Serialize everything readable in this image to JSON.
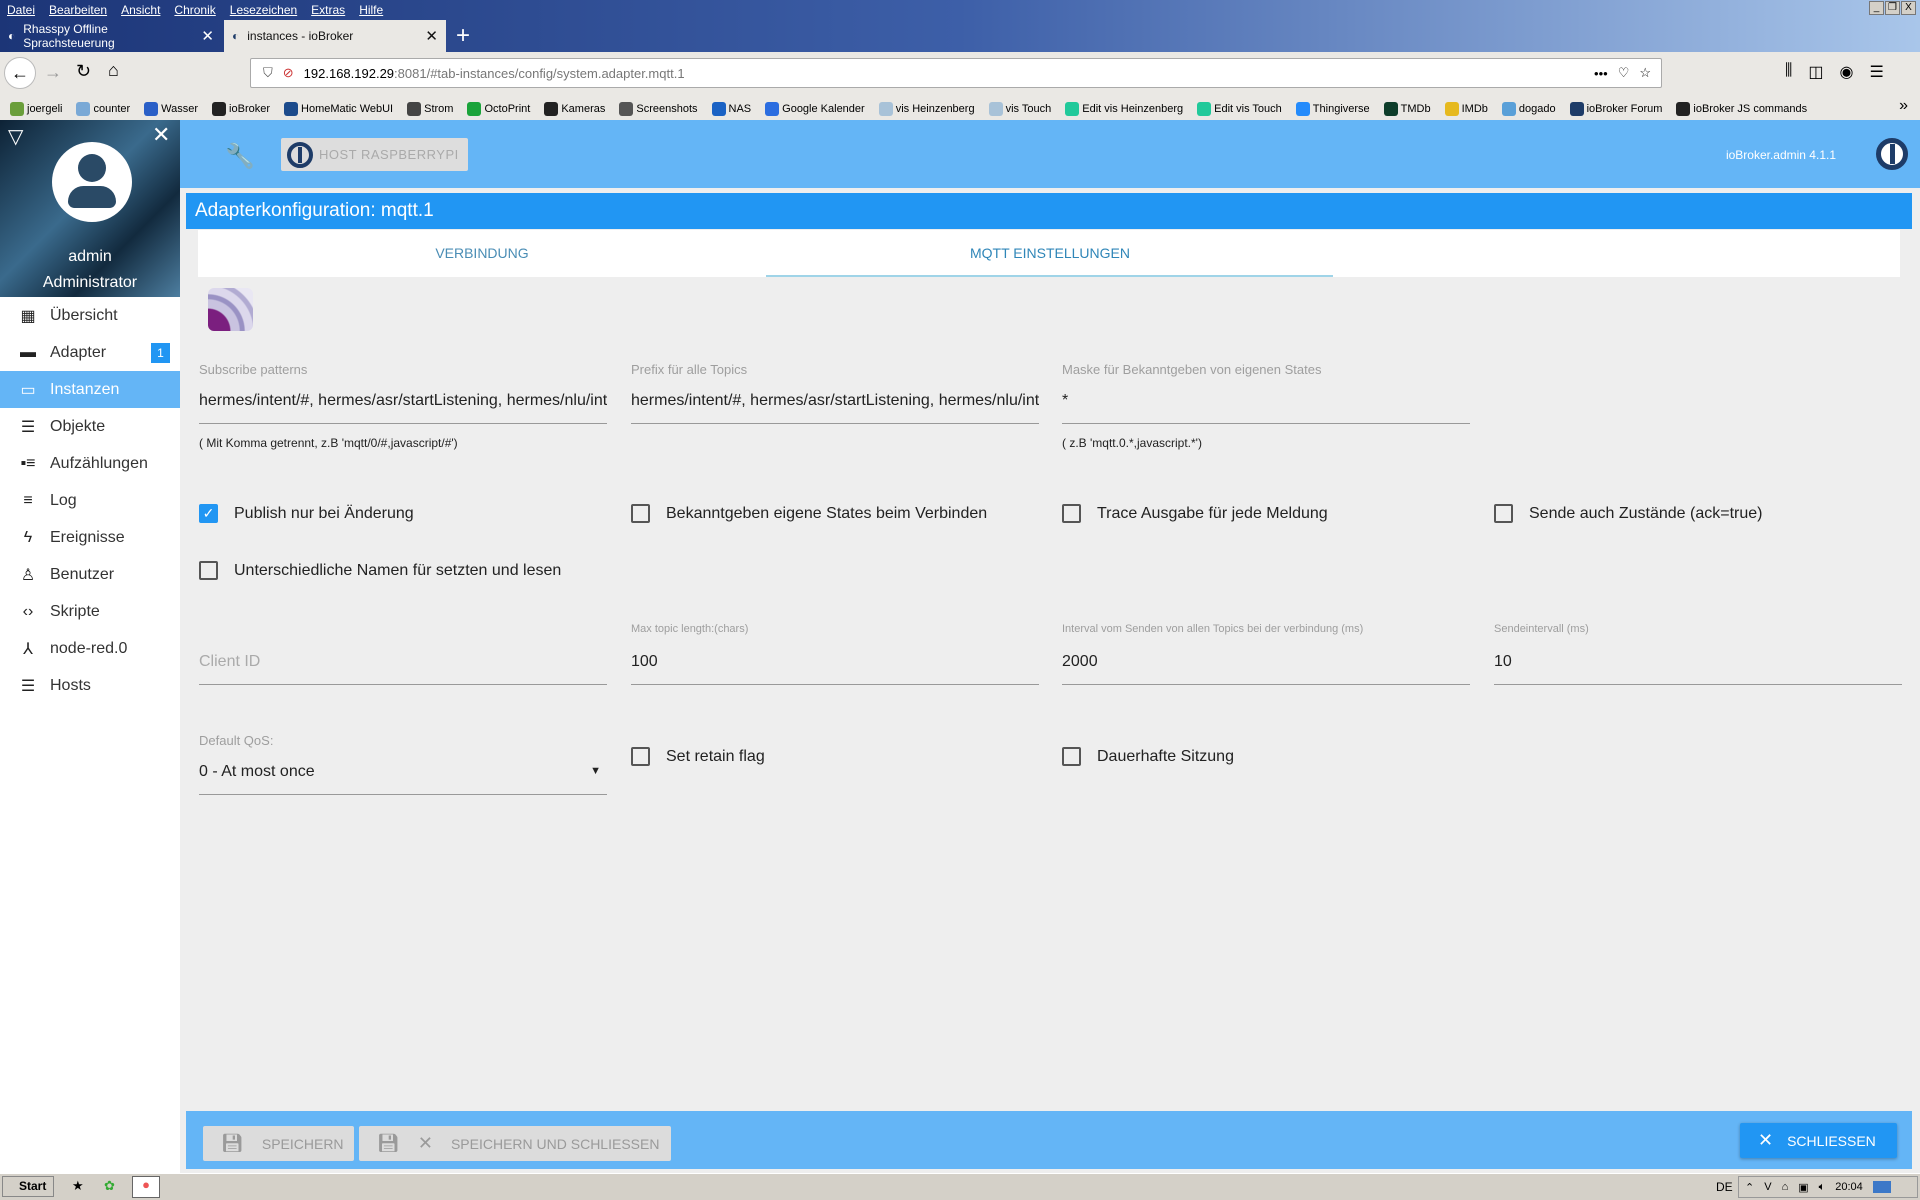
{
  "browser": {
    "menu": [
      "Datei",
      "Bearbeiten",
      "Ansicht",
      "Chronik",
      "Lesezeichen",
      "Extras",
      "Hilfe"
    ],
    "tabs": [
      {
        "title": "Rhasspy Offline Sprachsteuerung"
      },
      {
        "title": "instances - ioBroker"
      }
    ],
    "url_host": "192.168.192.29",
    "url_rest": ":8081/#tab-instances/config/system.adapter.mqtt.1",
    "bookmarks": [
      {
        "label": "joergeli",
        "color": "#6a9e3a"
      },
      {
        "label": "counter",
        "color": "#7aa9d6"
      },
      {
        "label": "Wasser",
        "color": "#2a5fc7"
      },
      {
        "label": "ioBroker",
        "color": "#222"
      },
      {
        "label": "HomeMatic WebUI",
        "color": "#1c4b8c"
      },
      {
        "label": "Strom",
        "color": "#444"
      },
      {
        "label": "OctoPrint",
        "color": "#1aa33a"
      },
      {
        "label": "Kameras",
        "color": "#222"
      },
      {
        "label": "Screenshots",
        "color": "#555"
      },
      {
        "label": "NAS",
        "color": "#1a62c4"
      },
      {
        "label": "Google Kalender",
        "color": "#2b6de0"
      },
      {
        "label": "vis Heinzenberg",
        "color": "#a8c2d8"
      },
      {
        "label": "vis Touch",
        "color": "#a8c2d8"
      },
      {
        "label": "Edit vis Heinzenberg",
        "color": "#21c99a"
      },
      {
        "label": "Edit vis Touch",
        "color": "#21c99a"
      },
      {
        "label": "Thingiverse",
        "color": "#248bfb"
      },
      {
        "label": "TMDb",
        "color": "#0d3d2a"
      },
      {
        "label": "IMDb",
        "color": "#e6b91e"
      },
      {
        "label": "dogado",
        "color": "#5aa0d8"
      },
      {
        "label": "ioBroker Forum",
        "color": "#1e3c68"
      },
      {
        "label": "ioBroker JS commands",
        "color": "#222"
      }
    ]
  },
  "sidebar": {
    "user": "admin",
    "role": "Administrator",
    "items": [
      {
        "label": "Übersicht",
        "icon": "apps-icon"
      },
      {
        "label": "Adapter",
        "icon": "store-icon",
        "badge": "1"
      },
      {
        "label": "Instanzen",
        "icon": "instances-icon",
        "active": true
      },
      {
        "label": "Objekte",
        "icon": "list-icon"
      },
      {
        "label": "Aufzählungen",
        "icon": "enums-icon"
      },
      {
        "label": "Log",
        "icon": "log-icon"
      },
      {
        "label": "Ereignisse",
        "icon": "flash-icon"
      },
      {
        "label": "Benutzer",
        "icon": "user-icon"
      },
      {
        "label": "Skripte",
        "icon": "code-icon"
      },
      {
        "label": "node-red.0",
        "icon": "node-red-icon"
      },
      {
        "label": "Hosts",
        "icon": "hosts-icon"
      }
    ]
  },
  "header": {
    "host_button": "HOST RASPBERRYPI",
    "version": "ioBroker.admin 4.1.1"
  },
  "config": {
    "title": "Adapterkonfiguration: mqtt.1",
    "tabs": [
      {
        "label": "VERBINDUNG"
      },
      {
        "label": "MQTT EINSTELLUNGEN",
        "active": true
      }
    ],
    "subscribe": {
      "label": "Subscribe patterns",
      "value": "hermes/intent/#, hermes/asr/startListening, hermes/nlu/intentNotRecognized",
      "help": "( Mit Komma getrennt, z.B 'mqtt/0/#,javascript/#')"
    },
    "prefix": {
      "label": "Prefix für alle Topics",
      "value": "hermes/intent/#, hermes/asr/startListening, hermes/nlu/intentNotRecognized"
    },
    "mask": {
      "label": "Maske für Bekanntgeben von eigenen States",
      "value": "*",
      "help": "( z.B 'mqtt.0.*,javascript.*')"
    },
    "checkboxes": {
      "publish_on_change": {
        "label": "Publish nur bei Änderung",
        "checked": true
      },
      "announce_on_connect": {
        "label": "Bekanntgeben eigene States beim Verbinden",
        "checked": false
      },
      "trace": {
        "label": "Trace Ausgabe für jede Meldung",
        "checked": false
      },
      "send_ack": {
        "label": "Sende auch Zustände (ack=true)",
        "checked": false
      },
      "different_names": {
        "label": "Unterschiedliche Namen für setzten und lesen",
        "checked": false
      },
      "retain": {
        "label": "Set retain flag",
        "checked": false
      },
      "persistent": {
        "label": "Dauerhafte Sitzung",
        "checked": false
      }
    },
    "client_id": {
      "placeholder": "Client ID",
      "value": ""
    },
    "max_topic": {
      "label": "Max topic length:(chars)",
      "value": "100"
    },
    "interval_all": {
      "label": "Interval vom Senden von allen Topics bei der verbindung (ms)",
      "value": "2000"
    },
    "send_interval": {
      "label": "Sendeintervall (ms)",
      "value": "10"
    },
    "qos": {
      "label": "Default QoS:",
      "value": "0 - At most once"
    }
  },
  "footer": {
    "save": "SPEICHERN",
    "save_close": "SPEICHERN UND SCHLIESSEN",
    "close": "SCHLIESSEN"
  },
  "taskbar": {
    "start": "Start",
    "lang": "DE",
    "time": "20:04"
  },
  "colors": {
    "primary": "#2196f3",
    "header": "#64b5f6"
  }
}
